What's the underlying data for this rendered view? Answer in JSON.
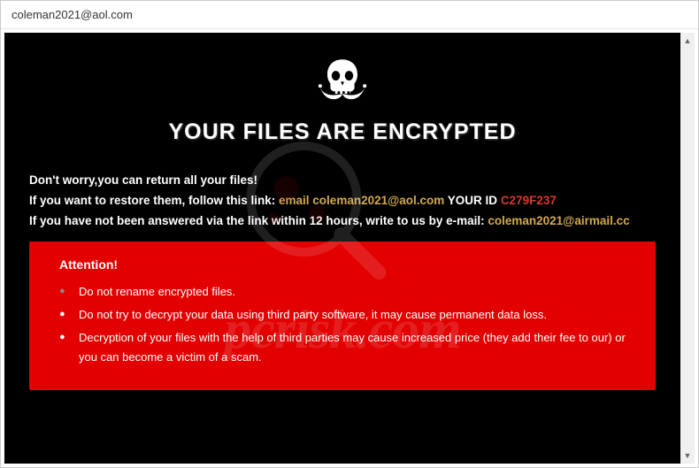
{
  "titlebar": {
    "title": "coleman2021@aol.com"
  },
  "heading": "YOUR FILES ARE ENCRYPTED",
  "intro": {
    "line1": "Don't worry,you can return all your files!",
    "line2_pre": "If you want to restore them, follow this link: ",
    "line2_email_label": "email coleman2021@aol.com",
    "line2_id_label": "  YOUR ID ",
    "line2_id_value": "C279F237",
    "line3_pre": "If you have not been answered via the link within 12 hours, write to us by e-mail: ",
    "line3_email": "coleman2021@airmail.cc"
  },
  "attention": {
    "title": "Attention!",
    "items": [
      "Do not rename encrypted files.",
      "Do not try to decrypt your data using third party software, it may cause permanent data loss.",
      "Decryption of your files with the help of third parties may cause increased price (they add their fee to our) or you can become a victim of a scam."
    ]
  },
  "watermark": {
    "text": "pcrisk.com"
  }
}
